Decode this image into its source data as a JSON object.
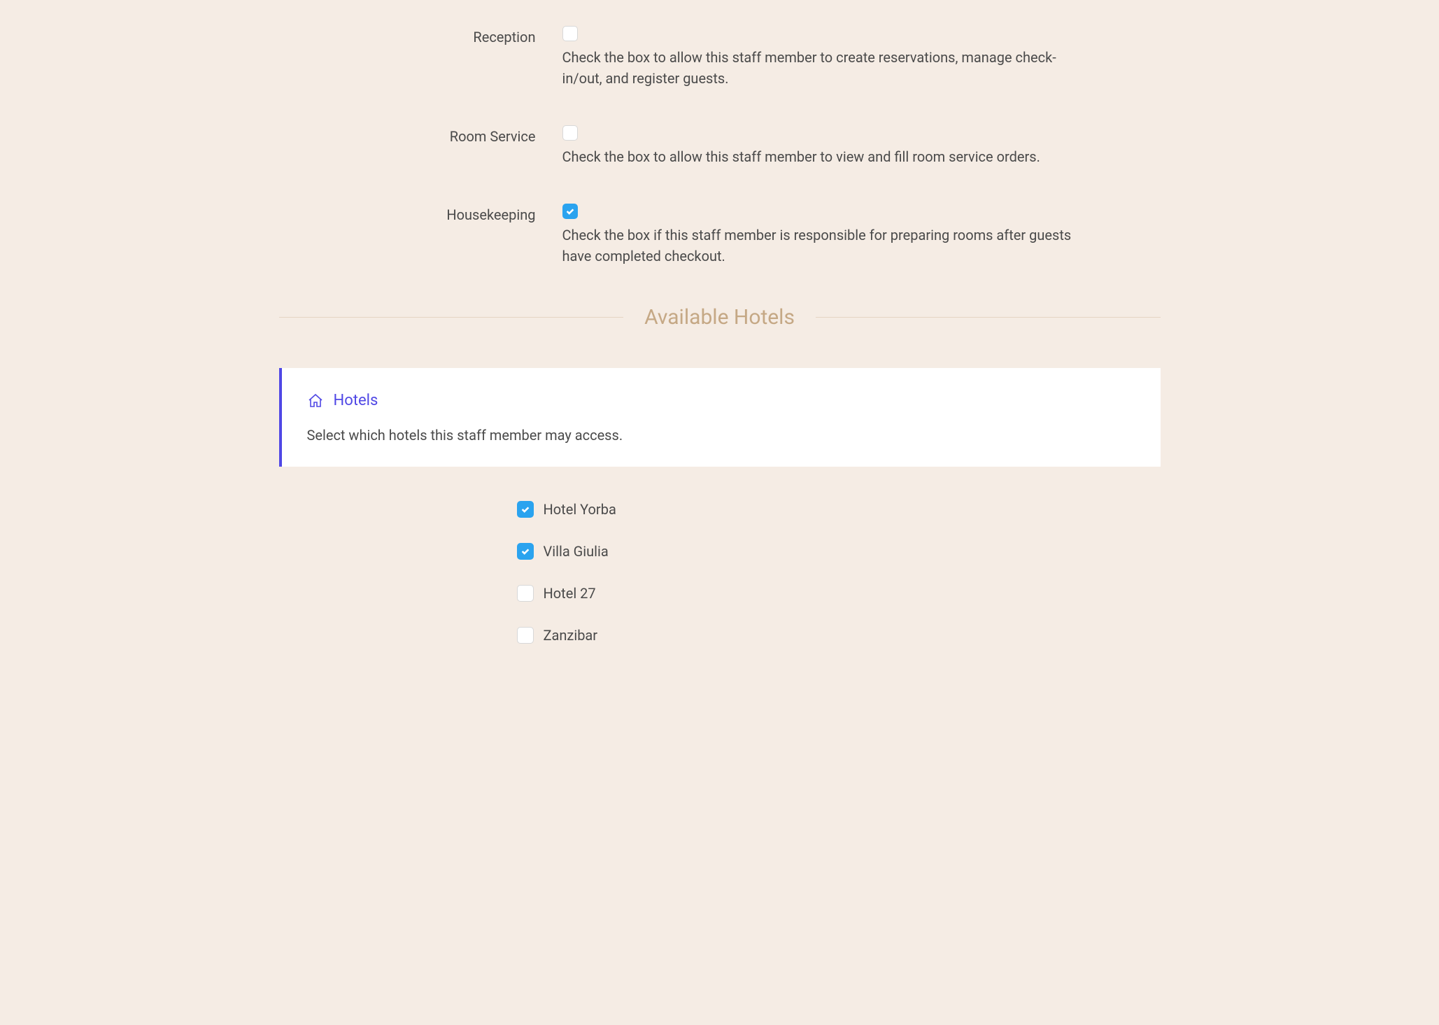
{
  "permissions": [
    {
      "label": "Reception",
      "checked": false,
      "description": "Check the box to allow this staff member to create reservations, manage check-in/out, and register guests."
    },
    {
      "label": "Room Service",
      "checked": false,
      "description": "Check the box to allow this staff member to view and fill room service orders."
    },
    {
      "label": "Housekeeping",
      "checked": true,
      "description": "Check the box if this staff member is responsible for preparing rooms after guests have completed checkout."
    }
  ],
  "section_title": "Available Hotels",
  "info_card": {
    "title": "Hotels",
    "description": "Select which hotels this staff member may access."
  },
  "hotels": [
    {
      "label": "Hotel Yorba",
      "checked": true
    },
    {
      "label": "Villa Giulia",
      "checked": true
    },
    {
      "label": "Hotel 27",
      "checked": false
    },
    {
      "label": "Zanzibar",
      "checked": false
    }
  ]
}
